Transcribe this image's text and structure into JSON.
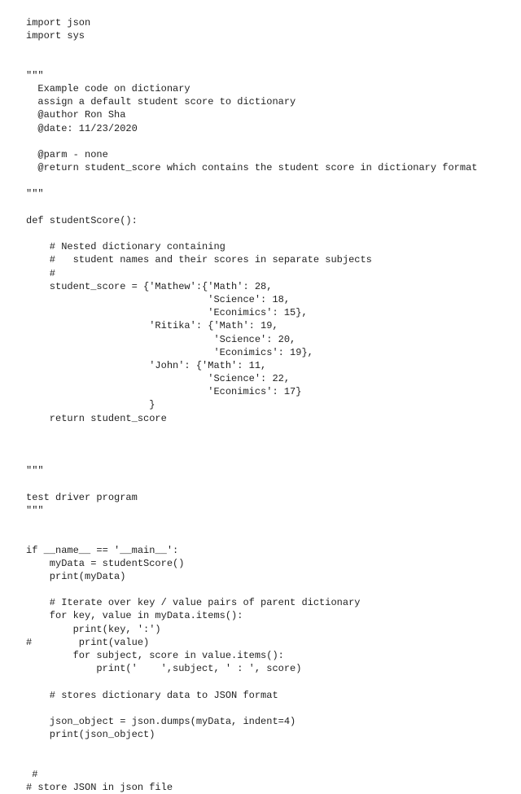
{
  "code": {
    "lines": [
      "import json",
      "import sys",
      "",
      "",
      "\"\"\"",
      "  Example code on dictionary",
      "  assign a default student score to dictionary",
      "  @author Ron Sha",
      "  @date: 11/23/2020",
      "",
      "  @parm - none",
      "  @return student_score which contains the student score in dictionary format",
      "",
      "\"\"\"",
      "",
      "def studentScore():",
      "",
      "    # Nested dictionary containing",
      "    #   student names and their scores in separate subjects",
      "    #",
      "    student_score = {'Mathew':{'Math': 28,",
      "                               'Science': 18,",
      "                               'Econimics': 15},",
      "                     'Ritika': {'Math': 19,",
      "                                'Science': 20,",
      "                                'Econimics': 19},",
      "                     'John': {'Math': 11,",
      "                               'Science': 22,",
      "                               'Econimics': 17}",
      "                     }",
      "    return student_score",
      "",
      "",
      "",
      "\"\"\"",
      "",
      "test driver program",
      "\"\"\"",
      "",
      "",
      "if __name__ == '__main__':",
      "    myData = studentScore()",
      "    print(myData)",
      "",
      "    # Iterate over key / value pairs of parent dictionary",
      "    for key, value in myData.items():",
      "        print(key, ':')",
      "#        print(value)",
      "        for subject, score in value.items():",
      "            print('    ',subject, ' : ', score)",
      "",
      "    # stores dictionary data to JSON format",
      "",
      "    json_object = json.dumps(myData, indent=4)",
      "    print(json_object)",
      "",
      "",
      " #",
      "# store JSON in json file"
    ]
  }
}
